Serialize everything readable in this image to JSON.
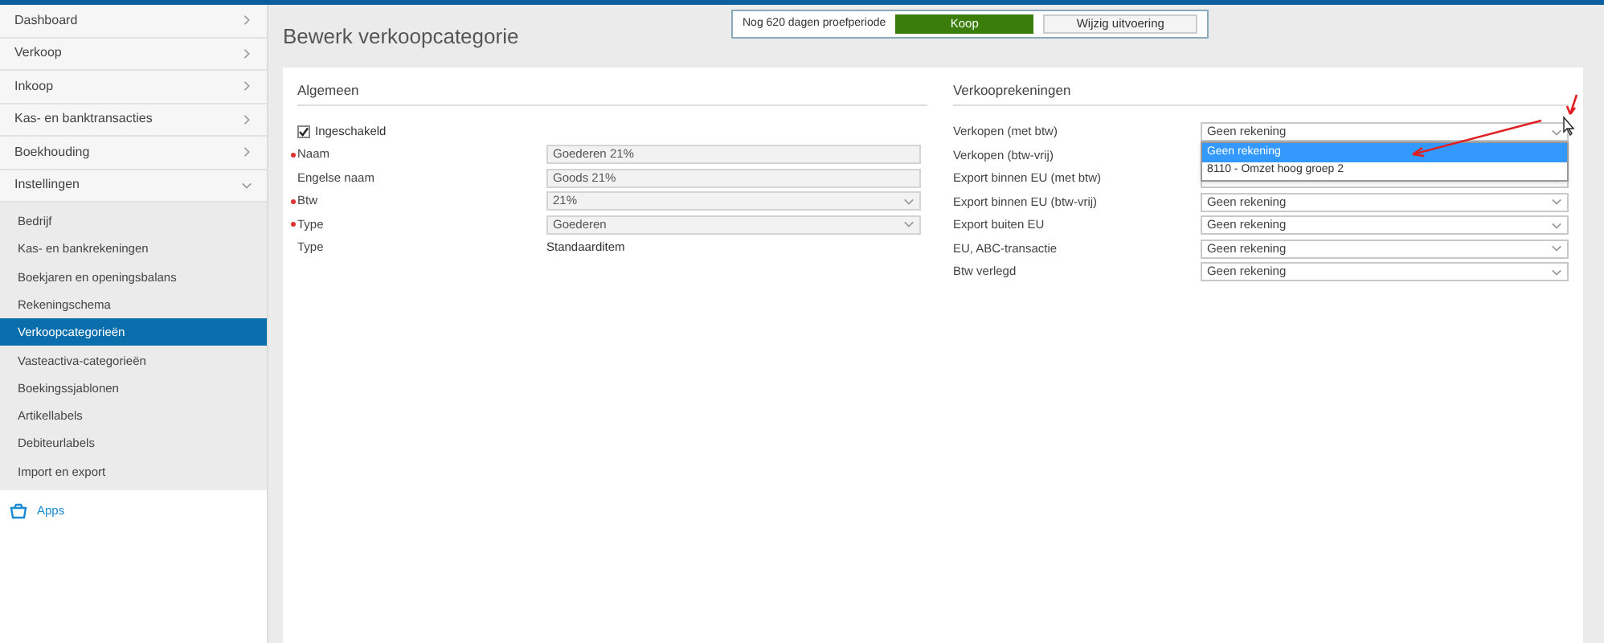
{
  "sidebar": {
    "items": [
      {
        "label": "Dashboard",
        "expanded": false
      },
      {
        "label": "Verkoop",
        "expanded": false
      },
      {
        "label": "Inkoop",
        "expanded": false
      },
      {
        "label": "Kas- en banktransacties",
        "expanded": false
      },
      {
        "label": "Boekhouding",
        "expanded": false
      },
      {
        "label": "Instellingen",
        "expanded": true,
        "children": [
          {
            "label": "Bedrijf",
            "selected": false
          },
          {
            "label": "Kas- en bankrekeningen",
            "selected": false
          },
          {
            "label": "Boekjaren en openingsbalans",
            "selected": false
          },
          {
            "label": "Rekeningschema",
            "selected": false
          },
          {
            "label": "Verkoopcategorieën",
            "selected": true
          },
          {
            "label": "Vasteactiva-categorieën",
            "selected": false
          },
          {
            "label": "Boekingssjablonen",
            "selected": false
          },
          {
            "label": "Artikellabels",
            "selected": false
          },
          {
            "label": "Debiteurlabels",
            "selected": false
          },
          {
            "label": "Import en export",
            "selected": false
          }
        ]
      }
    ],
    "apps": "Apps"
  },
  "page_title": "Bewerk verkoopcategorie",
  "trial": {
    "text": "Nog 620 dagen proefperiode",
    "buy": "Koop",
    "change": "Wijzig uitvoering"
  },
  "general": {
    "title": "Algemeen",
    "enabled": {
      "label": "Ingeschakeld",
      "checked": true
    },
    "fields": [
      {
        "kind": "input",
        "label": "Naam",
        "required": true,
        "value": "Goederen 21%"
      },
      {
        "kind": "input",
        "label": "Engelse naam",
        "required": false,
        "value": "Goods 21%"
      },
      {
        "kind": "select",
        "label": "Btw",
        "required": true,
        "value": "21%"
      },
      {
        "kind": "select",
        "label": "Type",
        "required": true,
        "value": "Goederen"
      },
      {
        "kind": "text",
        "label": "Type",
        "required": false,
        "value": "Standaarditem"
      }
    ]
  },
  "accounts": {
    "title": "Verkooprekeningen",
    "rows": [
      {
        "label": "Verkopen (met btw)",
        "value": "Geen rekening",
        "open": true,
        "options": [
          {
            "label": "Geen rekening",
            "selected": true
          },
          {
            "label": "8110 - Omzet hoog groep 2",
            "selected": false
          }
        ]
      },
      {
        "label": "Verkopen (btw-vrij)",
        "open": false
      },
      {
        "label": "Export binnen EU (met btw)",
        "open": false
      },
      {
        "label": "Export binnen EU (btw-vrij)",
        "value": "Geen rekening",
        "open": false
      },
      {
        "label": "Export buiten EU",
        "value": "Geen rekening",
        "open": false
      },
      {
        "label": "EU, ABC-transactie",
        "value": "Geen rekening",
        "open": false
      },
      {
        "label": "Btw verlegd",
        "value": "Geen rekening",
        "open": false
      }
    ]
  }
}
